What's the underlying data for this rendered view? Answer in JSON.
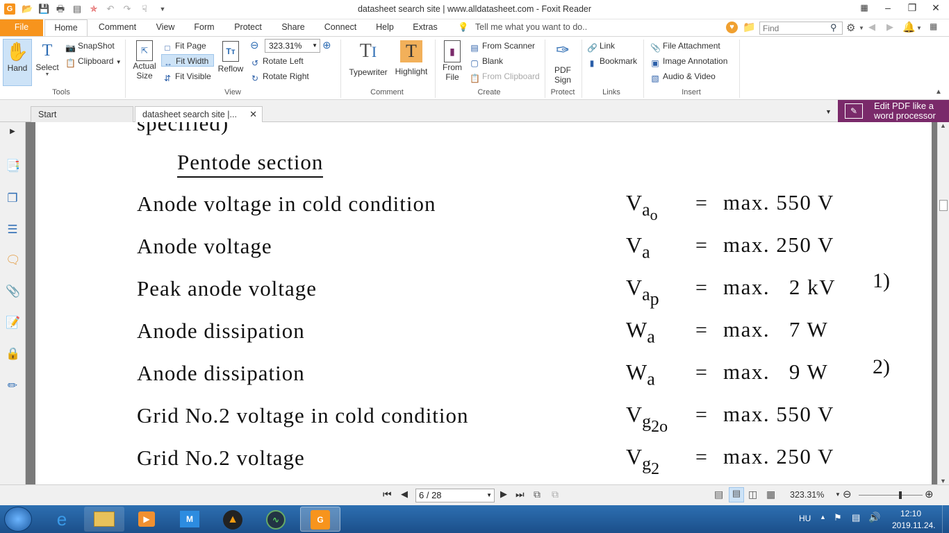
{
  "window": {
    "title": "datasheet search site | www.alldatasheet.com - Foxit Reader"
  },
  "search": {
    "placeholder": "Find"
  },
  "ribbon_tabs": [
    "File",
    "Home",
    "Comment",
    "View",
    "Form",
    "Protect",
    "Share",
    "Connect",
    "Help",
    "Extras"
  ],
  "tell_me": "Tell me what you want to do..",
  "tools_group": {
    "label": "Tools",
    "hand": "Hand",
    "select": "Select",
    "snapshot": "SnapShot",
    "clipboard": "Clipboard"
  },
  "view_group": {
    "label": "View",
    "actual_size_1": "Actual",
    "actual_size_2": "Size",
    "fit_page": "Fit Page",
    "fit_width": "Fit Width",
    "fit_visible": "Fit Visible",
    "reflow": "Reflow",
    "zoom_value": "323.31%",
    "rotate_left": "Rotate Left",
    "rotate_right": "Rotate Right"
  },
  "comment_group": {
    "label": "Comment",
    "typewriter": "Typewriter",
    "highlight": "Highlight"
  },
  "create_group": {
    "label": "Create",
    "from_file_1": "From",
    "from_file_2": "File",
    "from_scanner": "From Scanner",
    "blank": "Blank",
    "from_clipboard": "From Clipboard"
  },
  "protect_group": {
    "label": "Protect",
    "pdf_sign_1": "PDF",
    "pdf_sign_2": "Sign"
  },
  "links_group": {
    "label": "Links",
    "link": "Link",
    "bookmark": "Bookmark"
  },
  "insert_group": {
    "label": "Insert",
    "file_attachment": "File Attachment",
    "image_annotation": "Image Annotation",
    "audio_video": "Audio & Video"
  },
  "doc_tabs": {
    "start": "Start",
    "current": "datasheet search site |..."
  },
  "promo": {
    "line1": "Edit PDF like a",
    "line2": "word processor"
  },
  "document": {
    "top_fragment": "specified)",
    "heading": "Pentode section",
    "rows": [
      {
        "label": "Anode voltage in cold condition",
        "sym": "V",
        "sub": "a",
        "subsub": "o",
        "eq": "=",
        "value": "max. 550 V",
        "note": ""
      },
      {
        "label": "Anode voltage",
        "sym": "V",
        "sub": "a",
        "subsub": "",
        "eq": "=",
        "value": "max. 250 V",
        "note": ""
      },
      {
        "label": "Peak anode voltage",
        "sym": "V",
        "sub": "a",
        "subsub": "p",
        "eq": "=",
        "value": "max.   2 kV",
        "note": "1)"
      },
      {
        "label": "Anode dissipation",
        "sym": "W",
        "sub": "a",
        "subsub": "",
        "eq": "=",
        "value": "max.   7 W",
        "note": ""
      },
      {
        "label": "Anode dissipation",
        "sym": "W",
        "sub": "a",
        "subsub": "",
        "eq": "=",
        "value": "max.   9 W",
        "note": "2)"
      },
      {
        "label": "Grid No.2 voltage in cold condition",
        "sym": "V",
        "sub": "g",
        "subsub": "2o",
        "eq": "=",
        "value": "max. 550 V",
        "note": ""
      },
      {
        "label": "Grid No.2 voltage",
        "sym": "V",
        "sub": "g",
        "subsub": "2",
        "eq": "=",
        "value": "max. 250 V",
        "note": ""
      }
    ]
  },
  "status": {
    "page_indicator": "6 / 28",
    "zoom": "323.31%"
  },
  "taskbar": {
    "language": "HU",
    "time": "12:10",
    "date": "2019.11.24."
  }
}
